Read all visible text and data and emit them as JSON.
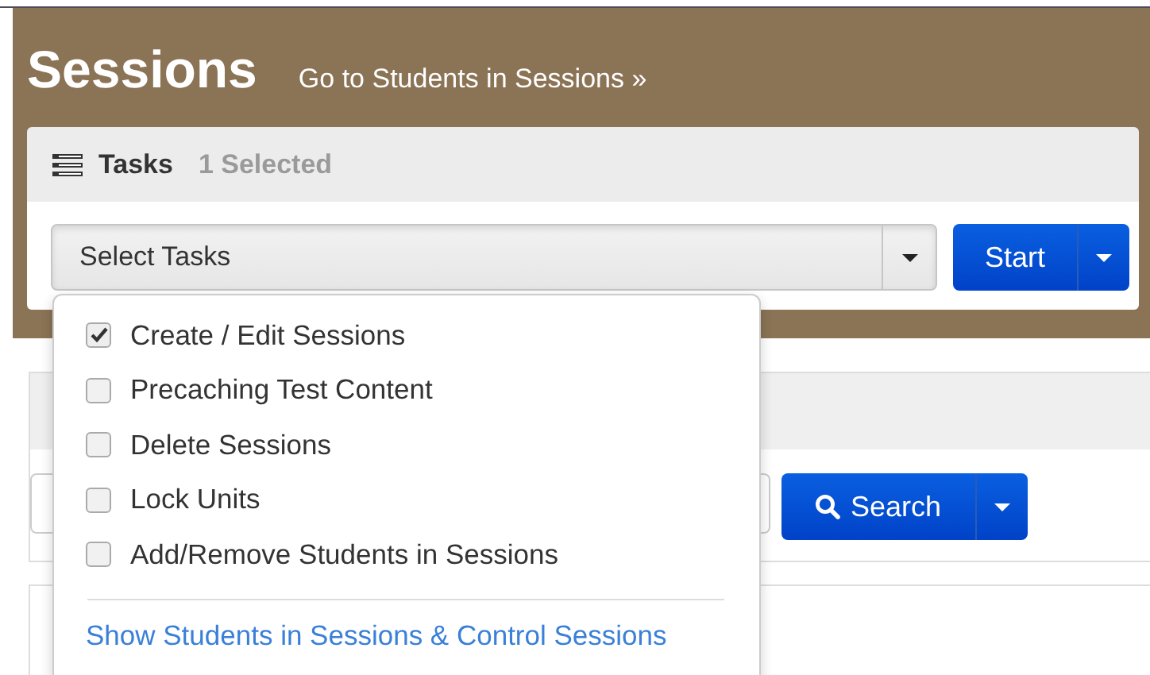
{
  "header": {
    "title": "Sessions",
    "link": "Go to Students in Sessions »"
  },
  "tasks_panel": {
    "title": "Tasks",
    "selected_count": "1 Selected",
    "select": {
      "placeholder": "Select Tasks",
      "expanded": true
    },
    "start_button": "Start"
  },
  "task_menu": {
    "items": [
      {
        "label": "Create / Edit Sessions",
        "checked": true
      },
      {
        "label": "Precaching Test Content",
        "checked": false
      },
      {
        "label": "Delete Sessions",
        "checked": false
      },
      {
        "label": "Lock Units",
        "checked": false
      },
      {
        "label": "Add/Remove Students in Sessions",
        "checked": false
      }
    ],
    "footer_link": "Show Students in Sessions & Control Sessions"
  },
  "search_panel": {
    "search_button": "Search"
  }
}
